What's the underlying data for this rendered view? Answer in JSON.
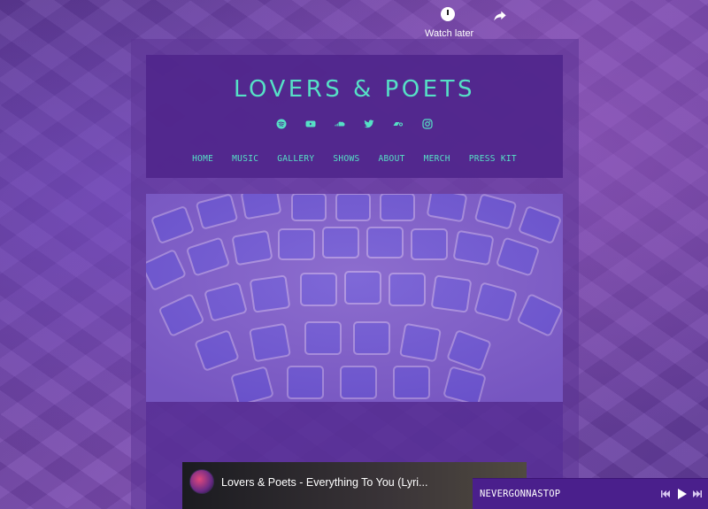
{
  "site": {
    "title": "LOVERS & POETS"
  },
  "social": [
    {
      "name": "spotify-icon"
    },
    {
      "name": "youtube-icon"
    },
    {
      "name": "soundcloud-icon"
    },
    {
      "name": "twitter-icon"
    },
    {
      "name": "bandcamp-icon"
    },
    {
      "name": "instagram-icon"
    }
  ],
  "nav": {
    "items": [
      "HOME",
      "MUSIC",
      "GALLERY",
      "SHOWS",
      "ABOUT",
      "MERCH",
      "PRESS KIT"
    ]
  },
  "video": {
    "title": "Lovers & Poets - Everything To You (Lyri...",
    "watch_later": "Watch later"
  },
  "player": {
    "track": "NEVERGONNASTOP"
  },
  "colors": {
    "accent": "#56e0c6",
    "panel": "#50268c",
    "player_bar": "#4a1f8c"
  }
}
